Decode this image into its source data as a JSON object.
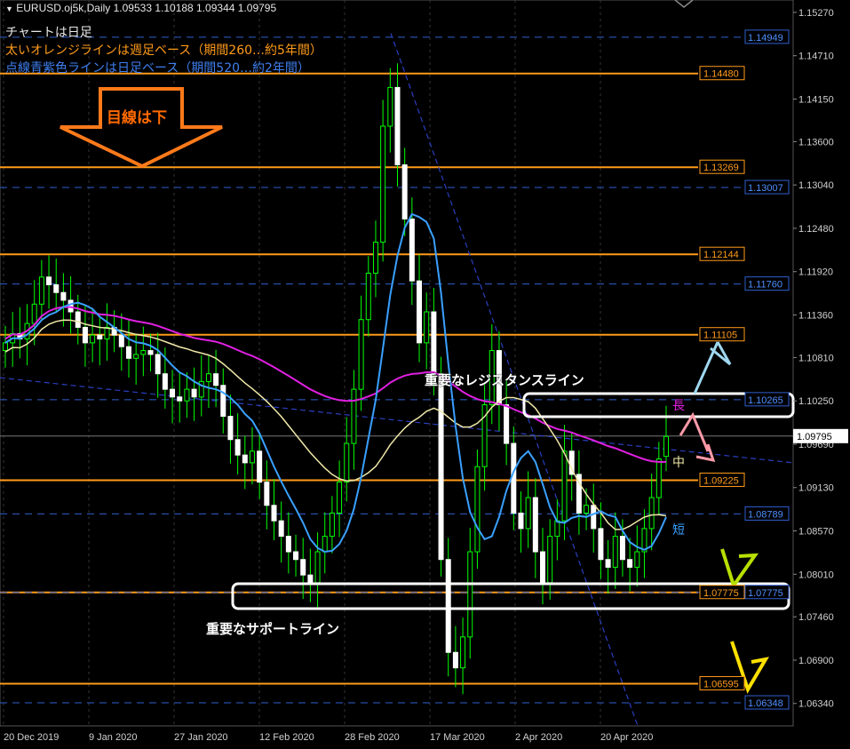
{
  "header": {
    "symbol_line": "EURUSD.oj5k,Daily  1.09533 1.10188 1.09344 1.09795",
    "note1": "チャートは日足",
    "note2": "太いオレンジラインは週足ベース（期間260…約5年間）",
    "note3": "点線青紫色ラインは日足ベース（期間520…約2年間）"
  },
  "annotations": {
    "arrow_label": "目線は下",
    "resistance_label": "重要なレジスタンスライン",
    "support_label": "重要なサポートライン",
    "ma_long": "長",
    "ma_mid": "中",
    "ma_short": "短"
  },
  "colors": {
    "background": "#000000",
    "grid": "#2a2a2a",
    "orange": "#ff9b1a",
    "blue": "#2f5fd0",
    "candle": "#00ff00",
    "ma_long": "#e020e0",
    "ma_mid": "#f0e8a8",
    "ma_short": "#3aa0ff"
  },
  "chart_data": {
    "type": "candlestick",
    "symbol": "EURUSD.oj5k",
    "timeframe": "Daily",
    "current_ohlc": {
      "open": 1.09533,
      "high": 1.10188,
      "low": 1.09344,
      "close": 1.09795
    },
    "current_price_label": "1.09795",
    "ylim": [
      1.0605,
      1.1543
    ],
    "y_ticks": [
      "1.15270",
      "1.14710",
      "1.14150",
      "1.13600",
      "1.13040",
      "1.12480",
      "1.11920",
      "1.11360",
      "1.10810",
      "1.10250",
      "1.09690",
      "1.09130",
      "1.08570",
      "1.08010",
      "1.07460",
      "1.06900",
      "1.06340"
    ],
    "x_ticks": [
      "20 Dec 2019",
      "9 Jan 2020",
      "27 Jan 2020",
      "12 Feb 2020",
      "28 Feb 2020",
      "17 Mar 2020",
      "2 Apr 2020",
      "20 Apr 2020"
    ],
    "orange_levels": [
      {
        "value": 1.1448,
        "label": "1.14480"
      },
      {
        "value": 1.13269,
        "label": "1.13269"
      },
      {
        "value": 1.12144,
        "label": "1.12144"
      },
      {
        "value": 1.11105,
        "label": "1.11105"
      },
      {
        "value": 1.09225,
        "label": "1.09225"
      },
      {
        "value": 1.07775,
        "label": "1.07775"
      },
      {
        "value": 1.06595,
        "label": "1.06595"
      }
    ],
    "blue_levels": [
      {
        "value": 1.14949,
        "label": "1.14949"
      },
      {
        "value": 1.13007,
        "label": "1.13007"
      },
      {
        "value": 1.1176,
        "label": "1.11760"
      },
      {
        "value": 1.10265,
        "label": "1.10265"
      },
      {
        "value": 1.08789,
        "label": "1.08789"
      },
      {
        "value": 1.07775,
        "label": "1.07775"
      },
      {
        "value": 1.06348,
        "label": "1.06348"
      }
    ],
    "closes": [
      1.11,
      1.1112,
      1.1105,
      1.1125,
      1.115,
      1.1185,
      1.1175,
      1.1165,
      1.1155,
      1.114,
      1.112,
      1.11,
      1.111,
      1.1105,
      1.112,
      1.111,
      1.1095,
      1.108,
      1.1085,
      1.109,
      1.1085,
      1.106,
      1.104,
      1.103,
      1.1025,
      1.104,
      1.103,
      1.105,
      1.106,
      1.1045,
      1.1005,
      1.0975,
      1.0955,
      1.0945,
      1.096,
      1.092,
      1.089,
      1.087,
      1.085,
      1.083,
      1.082,
      1.08,
      1.079,
      1.083,
      1.085,
      1.088,
      1.092,
      1.097,
      1.104,
      1.113,
      1.119,
      1.123,
      1.138,
      1.143,
      1.133,
      1.126,
      1.118,
      1.11,
      1.114,
      1.106,
      1.082,
      1.07,
      1.068,
      1.072,
      1.083,
      1.094,
      1.102,
      1.109,
      1.102,
      1.097,
      1.088,
      1.086,
      1.09,
      1.083,
      1.079,
      1.085,
      1.087,
      1.096,
      1.093,
      1.088,
      1.089,
      1.086,
      1.082,
      1.081,
      1.085,
      1.082,
      1.081,
      1.083,
      1.086,
      1.09,
      1.095,
      1.0979
    ],
    "moving_averages": [
      "long",
      "mid",
      "short"
    ]
  }
}
